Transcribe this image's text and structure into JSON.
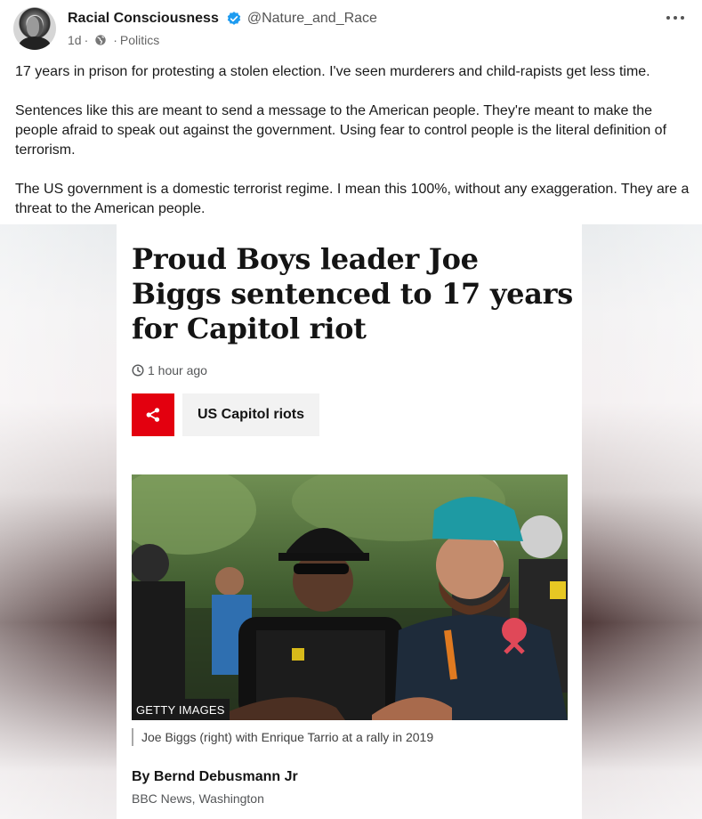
{
  "post": {
    "author": {
      "name": "Racial Consciousness",
      "handle": "@Nature_and_Race",
      "verified_color": "#1d9bf0"
    },
    "age": "1d",
    "separator": "·",
    "audience_icon": "globe-icon",
    "category": "Politics",
    "more_icon": "more-horizontal-icon",
    "paragraphs": [
      "17 years in prison for protesting a stolen election. I've seen murderers and child-rapists get less time.",
      "Sentences like this are meant to send a message to the American people. They're meant to make the people afraid to speak out against the government. Using fear to control people is the literal definition of terrorism.",
      "The US government is a domestic terrorist regime. I mean this 100%, without any exaggeration. They are a threat to the American people."
    ]
  },
  "article": {
    "headline": "Proud Boys leader Joe Biggs sentenced to 17 years for Capitol riot",
    "timestamp": "1 hour ago",
    "share_color": "#e3000f",
    "share_icon": "share-icon",
    "topic": "US Capitol riots",
    "photo_credit": "GETTY IMAGES",
    "caption": "Joe Biggs (right) with Enrique Tarrio at a rally in 2019",
    "byline": "By Bernd Debusmann Jr",
    "outlet": "BBC News, Washington"
  }
}
